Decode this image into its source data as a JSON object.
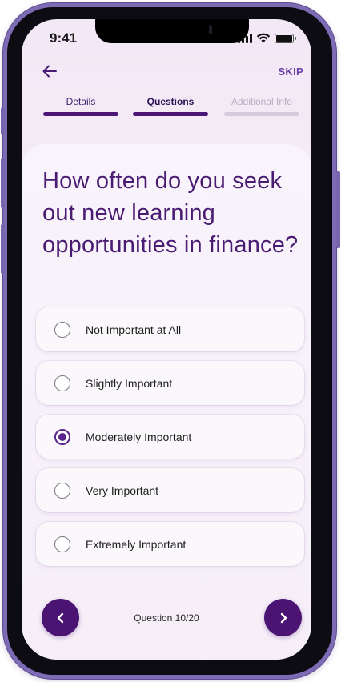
{
  "status_bar": {
    "time": "9:41"
  },
  "header": {
    "skip_label": "SKIP"
  },
  "steps": [
    {
      "label": "Details",
      "state": "done"
    },
    {
      "label": "Questions",
      "state": "active"
    },
    {
      "label": "Additional Info",
      "state": "pending"
    }
  ],
  "question": {
    "text": "How often do you seek out new learning opportunities in finance?"
  },
  "options": [
    {
      "label": "Not Important at All",
      "selected": false
    },
    {
      "label": "Slightly Important",
      "selected": false
    },
    {
      "label": "Moderately Important",
      "selected": true
    },
    {
      "label": "Very Important",
      "selected": false
    },
    {
      "label": "Extremely Important",
      "selected": false
    }
  ],
  "footer": {
    "progress_label": "Question 10/20"
  },
  "icons": {
    "back": "arrow-left-icon",
    "prev": "chevron-left-icon",
    "next": "chevron-right-icon",
    "radio": "radio-icon"
  },
  "colors": {
    "accent": "#4b1372",
    "question_text": "#4a1b72",
    "skip": "#6b3fa8",
    "pending_step": "#d6cbde"
  }
}
